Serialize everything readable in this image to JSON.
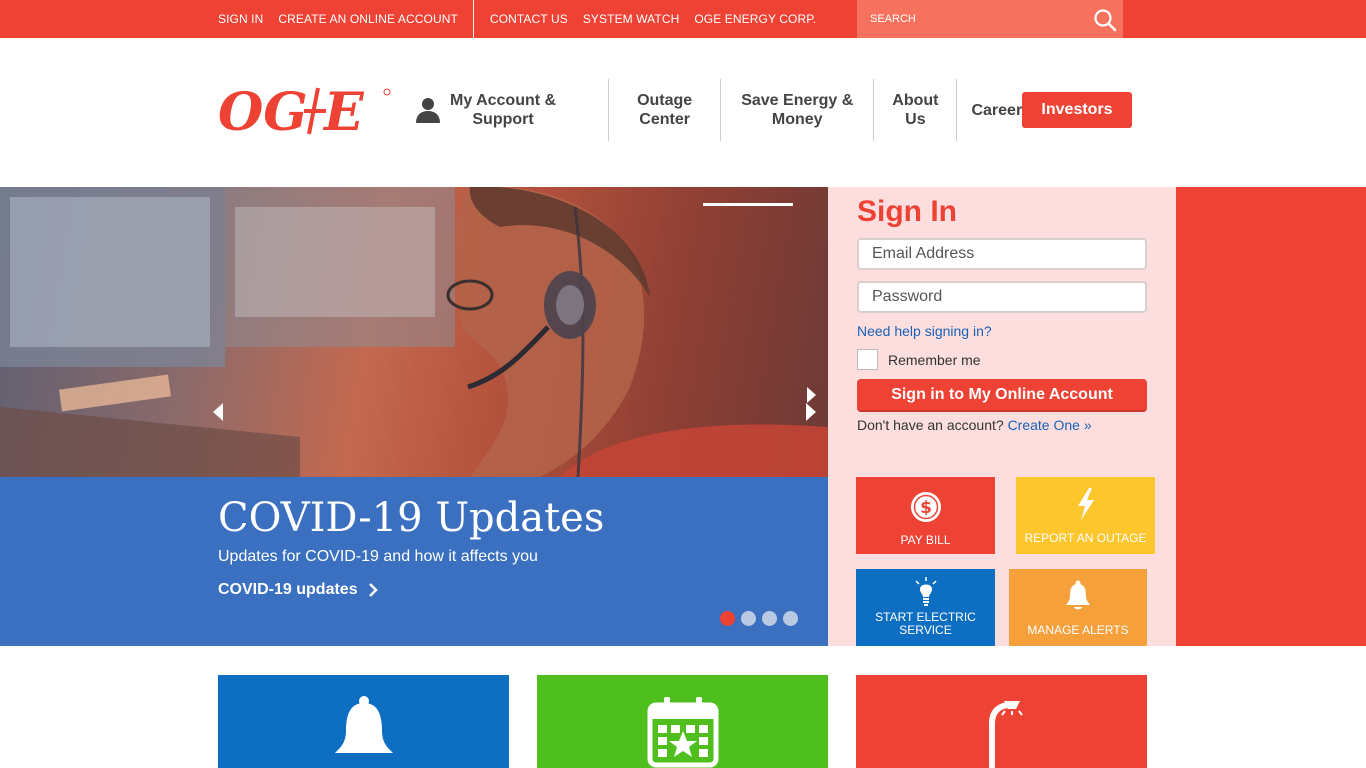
{
  "topbar": {
    "links": [
      "SIGN IN",
      "CREATE AN ONLINE ACCOUNT",
      "CONTACT US",
      "SYSTEM WATCH",
      "OGE ENERGY CORP."
    ],
    "search_placeholder": "SEARCH"
  },
  "header": {
    "logo_text": "OG+E",
    "nav": {
      "my_account_line1": "My Account &",
      "my_account_line2": "Support",
      "outage_line1": "Outage",
      "outage_line2": "Center",
      "save_line1": "Save Energy &",
      "save_line2": "Money",
      "about_line1": "About",
      "about_line2": "Us",
      "careers": "Careers"
    },
    "investors_button": "Investors"
  },
  "hero": {
    "title": "COVID-19 Updates",
    "subtitle": "Updates for COVID-19 and how it affects you",
    "cta": "COVID-19 updates",
    "slide_count": 4,
    "active_slide": 1
  },
  "signin": {
    "title": "Sign In",
    "email_placeholder": "Email Address",
    "password_placeholder": "Password",
    "help_link": "Need help signing in?",
    "remember_label": "Remember me",
    "submit_label": "Sign in to My Online Account",
    "no_account_text": "Don't have an account?",
    "create_link": "Create One »"
  },
  "tiles": {
    "pay_bill": "PAY BILL",
    "report_outage": "REPORT AN OUTAGE",
    "start_service_line1": "START ELECTRIC",
    "start_service_line2": "SERVICE",
    "manage_alerts": "MANAGE ALERTS"
  },
  "colors": {
    "brand_red": "#ee4235",
    "blue": "#0e6fc2",
    "yellow": "#fcc62c",
    "orange": "#f6a03b",
    "green": "#4fbf1d"
  }
}
